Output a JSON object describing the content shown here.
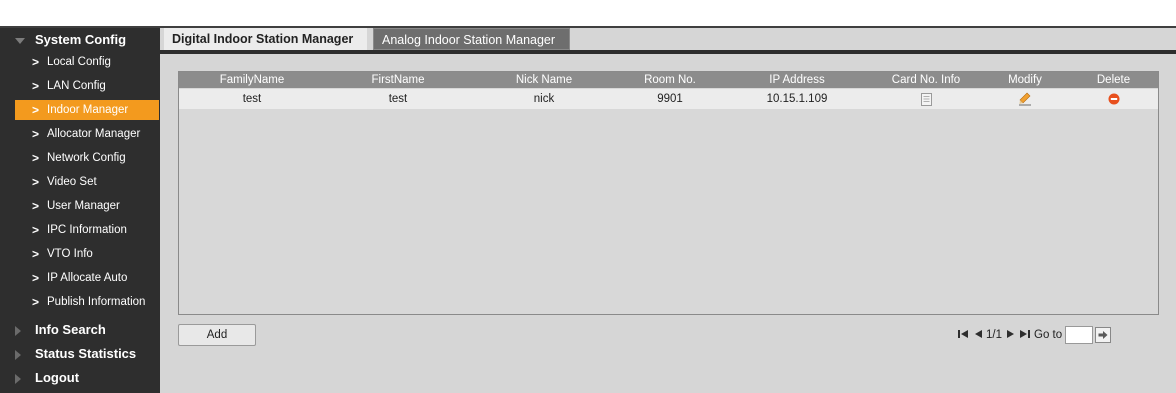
{
  "sidebar": {
    "system_config": "System Config",
    "items": [
      {
        "label": "Local Config"
      },
      {
        "label": "LAN Config"
      },
      {
        "label": "Indoor Manager"
      },
      {
        "label": "Allocator Manager"
      },
      {
        "label": "Network Config"
      },
      {
        "label": "Video Set"
      },
      {
        "label": "User Manager"
      },
      {
        "label": "IPC Information"
      },
      {
        "label": "VTO Info"
      },
      {
        "label": "IP Allocate Auto"
      },
      {
        "label": "Publish Information"
      }
    ],
    "active_item": "Indoor Manager",
    "info_search": "Info Search",
    "status_statistics": "Status Statistics",
    "logout": "Logout"
  },
  "tabs": {
    "digital": "Digital Indoor Station Manager",
    "analog": "Analog Indoor Station Manager"
  },
  "table": {
    "headers": [
      "FamilyName",
      "FirstName",
      "Nick Name",
      "Room No.",
      "IP Address",
      "Card No. Info",
      "Modify",
      "Delete"
    ],
    "rows": [
      {
        "family_name": "test",
        "first_name": "test",
        "nick_name": "nick",
        "room_no": "9901",
        "ip_address": "10.15.1.109"
      }
    ]
  },
  "add_button": "Add",
  "pager": {
    "page_info": "1/1",
    "goto_label": "Go to",
    "goto_value": ""
  },
  "icons": {
    "card_info": "document-icon",
    "modify": "pencil-icon",
    "delete": "minus-circle-icon"
  },
  "colors": {
    "accent": "#f39a1e",
    "sidebar_bg": "#2e2e2e",
    "header_bg": "#8c8c8c",
    "delete_red": "#e8501e"
  }
}
